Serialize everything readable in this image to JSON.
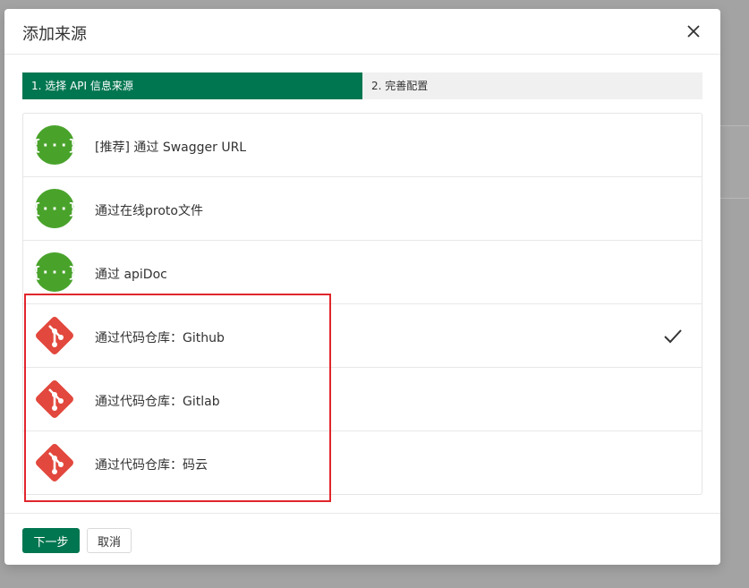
{
  "modal": {
    "title": "添加来源"
  },
  "steps": [
    {
      "label": "1. 选择 API 信息来源",
      "state": "active"
    },
    {
      "label": "2. 完善配置",
      "state": "inactive"
    }
  ],
  "sources": [
    {
      "label": "[推荐] 通过 Swagger URL",
      "icon": "swagger-icon",
      "selected": false
    },
    {
      "label": "通过在线proto文件",
      "icon": "swagger-icon",
      "selected": false
    },
    {
      "label": "通过 apiDoc",
      "icon": "swagger-icon",
      "selected": false
    },
    {
      "label": "通过代码仓库：Github",
      "icon": "git-icon",
      "selected": true
    },
    {
      "label": "通过代码仓库：Gitlab",
      "icon": "git-icon",
      "selected": false
    },
    {
      "label": "通过代码仓库：码云",
      "icon": "git-icon",
      "selected": false
    }
  ],
  "footer": {
    "next_label": "下一步",
    "cancel_label": "取消"
  },
  "colors": {
    "primary": "#007650",
    "swagger_green": "#49a32b",
    "git_red": "#e2483d",
    "highlight_red": "#e0262c"
  }
}
